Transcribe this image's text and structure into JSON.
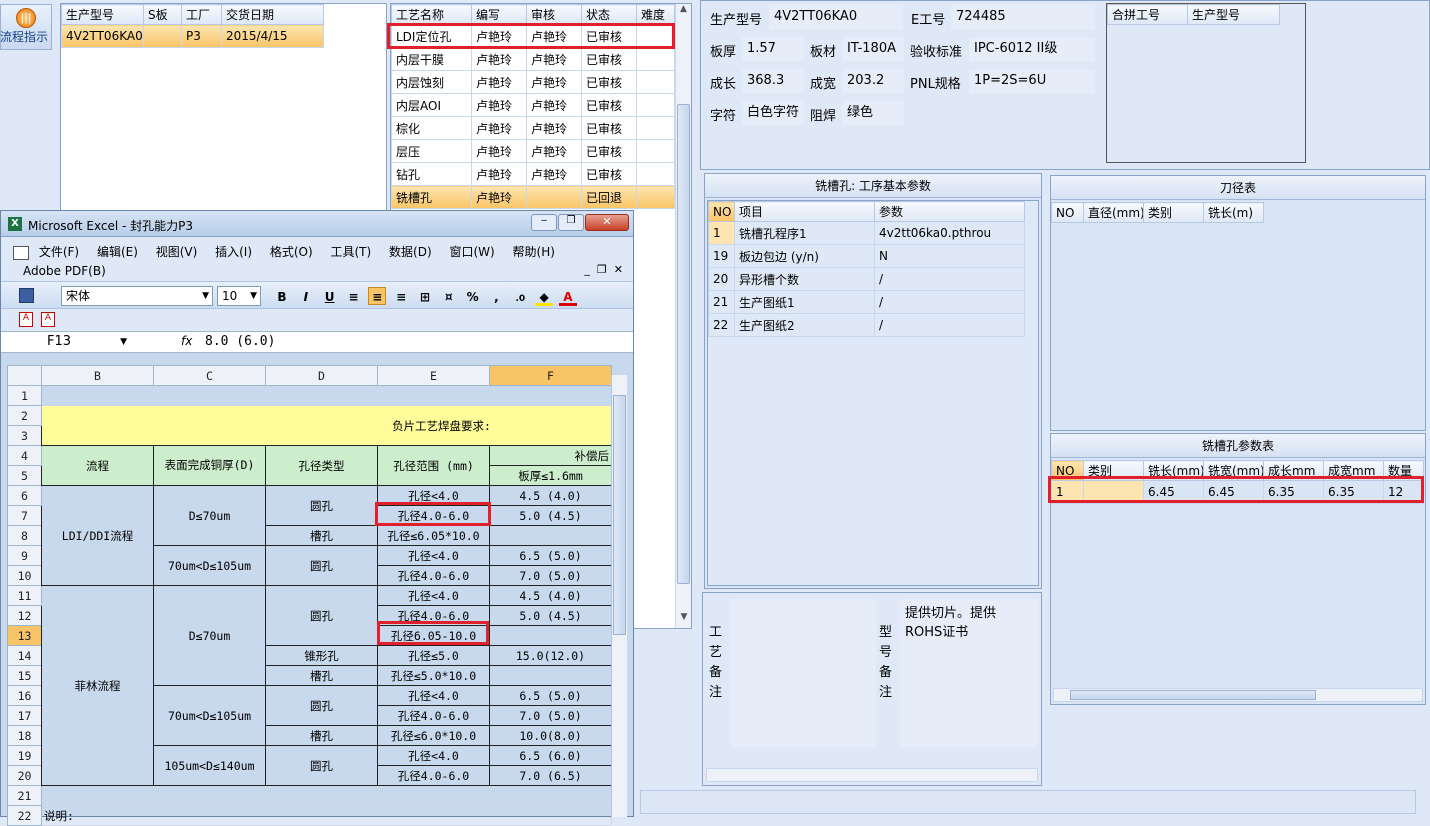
{
  "left_button": {
    "label": "流程指示"
  },
  "model_list": {
    "columns": [
      "生产型号",
      "S板",
      "工厂",
      "交货日期"
    ],
    "rows": [
      [
        "4V2TT06KA0",
        "",
        "P3",
        "2015/4/15"
      ]
    ]
  },
  "process_list": {
    "columns": [
      "工艺名称",
      "编写",
      "审核",
      "状态",
      "难度"
    ],
    "rows": [
      [
        "LDI定位孔",
        "卢艳玲",
        "卢艳玲",
        "已审核",
        ""
      ],
      [
        "内层干膜",
        "卢艳玲",
        "卢艳玲",
        "已审核",
        ""
      ],
      [
        "内层蚀刻",
        "卢艳玲",
        "卢艳玲",
        "已审核",
        ""
      ],
      [
        "内层AOI",
        "卢艳玲",
        "卢艳玲",
        "已审核",
        ""
      ],
      [
        "棕化",
        "卢艳玲",
        "卢艳玲",
        "已审核",
        ""
      ],
      [
        "层压",
        "卢艳玲",
        "卢艳玲",
        "已审核",
        ""
      ],
      [
        "钻孔",
        "卢艳玲",
        "卢艳玲",
        "已审核",
        ""
      ],
      [
        "铣槽孔",
        "卢艳玲",
        "",
        "已回退",
        ""
      ]
    ]
  },
  "info": {
    "model_label": "生产型号",
    "model": "4V2TT06KA0",
    "eno_label": "E工号",
    "eno": "724485",
    "thickness_label": "板厚",
    "thickness": "1.57",
    "material_label": "板材",
    "material": "IT-180A",
    "standard_label": "验收标准",
    "standard": "IPC-6012 II级",
    "length_label": "成长",
    "length": "368.3",
    "width_label": "成宽",
    "width": "203.2",
    "pnl_label": "PNL规格",
    "pnl": "1P=2S=6U",
    "char_label": "字符",
    "char": "白色字符",
    "mask_label": "阻焊",
    "mask": "绿色"
  },
  "combine": {
    "columns": [
      "合拼工号",
      "生产型号"
    ]
  },
  "basic_params": {
    "title": "铣槽孔: 工序基本参数",
    "columns": [
      "NO",
      "项目",
      "参数"
    ],
    "rows": [
      [
        "1",
        "铣槽孔程序1",
        "4v2tt06ka0.pthrou"
      ],
      [
        "19",
        "板边包边 (y/n)",
        "N"
      ],
      [
        "20",
        "异形槽个数",
        "/"
      ],
      [
        "21",
        "生产图纸1",
        "/"
      ],
      [
        "22",
        "生产图纸2",
        "/"
      ]
    ]
  },
  "tool_table": {
    "title": "刀径表",
    "columns": [
      "NO",
      "直径(mm)",
      "类别",
      "铣长(m)"
    ]
  },
  "slot_params": {
    "title": "铣槽孔参数表",
    "columns": [
      "NO",
      "类别",
      "铣长(mm)",
      "铣宽(mm)",
      "成长mm",
      "成宽mm",
      "数量"
    ],
    "rows": [
      [
        "1",
        "",
        "6.45",
        "6.45",
        "6.35",
        "6.35",
        "12"
      ]
    ]
  },
  "remarks": {
    "process_label": "工艺备注",
    "model_label": "型号备注",
    "model_text": "提供切片。提供ROHS证书"
  },
  "excel": {
    "title": "Microsoft Excel - 封孔能力P3",
    "menu": [
      "文件(F)",
      "编辑(E)",
      "视图(V)",
      "插入(I)",
      "格式(O)",
      "工具(T)",
      "数据(D)",
      "窗口(W)",
      "帮助(H)"
    ],
    "menu2": "Adobe PDF(B)",
    "font": "宋体",
    "size": "10",
    "cell_ref": "F13",
    "fx": "fx",
    "formula": "8.0 (6.0)",
    "col_headers": [
      "B",
      "C",
      "D",
      "E",
      "F"
    ],
    "row_numbers": [
      "1",
      "2",
      "3",
      "4",
      "5",
      "6",
      "7",
      "8",
      "9",
      "10",
      "11",
      "12",
      "13",
      "14",
      "15",
      "16",
      "17",
      "18",
      "19",
      "20",
      "21",
      "22"
    ],
    "banner": "负片工艺焊盘要求:",
    "hdr_flow": "流程",
    "hdr_thick": "表面完成铜厚(D)",
    "hdr_type": "孔径类型",
    "hdr_range": "孔径范围 (mm)",
    "hdr_comp": "补偿后",
    "hdr_comp_sub": "板厚≤1.6mm",
    "flow1": "LDI/DDI流程",
    "flow2": "菲林流程",
    "t_70": "D≤70um",
    "t_70_105": "70um<D≤105um",
    "t_105_140": "105um<D≤140um",
    "round": "圆孔",
    "slot": "槽孔",
    "cone": "锥形孔",
    "r6": "孔径<4.0",
    "f6": "4.5 (4.0)",
    "r7": "孔径4.0-6.0",
    "f7": "5.0 (4.5)",
    "r8": "孔径≤6.05*10.0",
    "r9": "孔径<4.0",
    "f9": "6.5 (5.0)",
    "r10": "孔径4.0-6.0",
    "f10": "7.0 (5.0)",
    "r11": "孔径<4.0",
    "f11": "4.5 (4.0)",
    "r12": "孔径4.0-6.0",
    "f12": "5.0 (4.5)",
    "r13": "孔径6.05-10.0",
    "r14": "孔径≤5.0",
    "f14": "15.0(12.0)",
    "r15": "孔径≤5.0*10.0",
    "r16": "孔径<4.0",
    "f16": "6.5 (5.0)",
    "r17": "孔径4.0-6.0",
    "f17": "7.0 (5.0)",
    "r18": "孔径≤6.0*10.0",
    "f18": "10.0(8.0)",
    "r19": "孔径<4.0",
    "f19": "6.5 (6.0)",
    "r20": "孔径4.0-6.0",
    "f20": "7.0 (6.5)",
    "note": "说明:"
  }
}
